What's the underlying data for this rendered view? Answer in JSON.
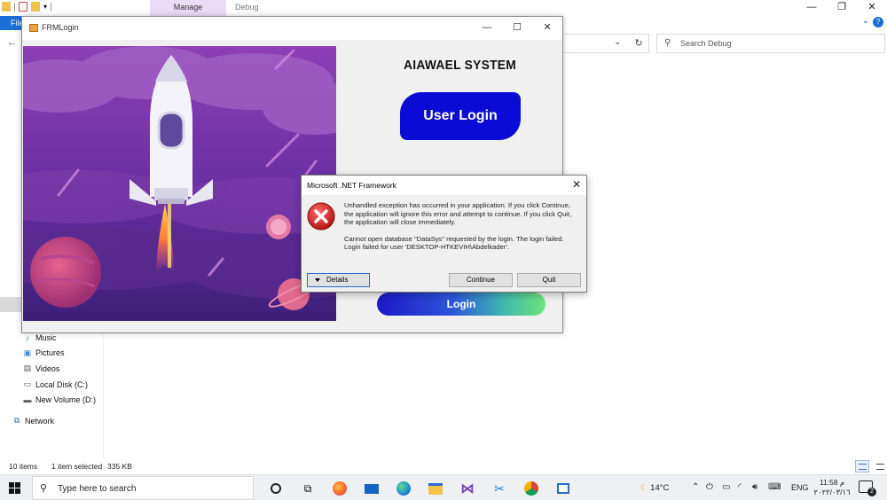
{
  "explorer": {
    "ribbon": {
      "manage_tab": "Manage",
      "debug_tab": "Debug",
      "file_tab": "File"
    },
    "search_placeholder": "Search Debug",
    "nav": [
      {
        "icon": "music-icon",
        "label": "Music"
      },
      {
        "icon": "pictures-icon",
        "label": "Pictures"
      },
      {
        "icon": "videos-icon",
        "label": "Videos"
      },
      {
        "icon": "drive-icon",
        "label": "Local Disk (C:)"
      },
      {
        "icon": "drive-icon",
        "label": "New Volume (D:)"
      },
      {
        "icon": "network-icon",
        "label": "Network"
      }
    ],
    "status": {
      "items": "10 items",
      "selected": "1 item selected",
      "size": "335 KB"
    }
  },
  "frm_login": {
    "title": "FRMLogin",
    "system_title": "AIAWAEL SYSTEM",
    "user_login": "User Login",
    "login_button": "Login"
  },
  "dialog": {
    "title": "Microsoft .NET Framework",
    "message_1": "Unhandled exception has occurred in your application. If you click Continue, the application will ignore this error and attempt to continue. If you click Quit, the application will close immediately.",
    "message_2": "Cannot open database \"DataSys\" requested by the login. The login failed.",
    "message_3": "Login failed for user 'DESKTOP-HTKEVIH\\Abdelkader'.",
    "details_button": "Details",
    "continue_button": "Continue",
    "quit_button": "Quit"
  },
  "taskbar": {
    "search_placeholder": "Type here to search",
    "weather": "14°C",
    "language": "ENG",
    "time": "11:58 م",
    "date": "٢٠٢٢/٠٣/١٦",
    "notification_count": "2",
    "apps": [
      "cortana-icon",
      "task-view-icon",
      "firefox-icon",
      "mail-icon",
      "edge-icon",
      "file-explorer-icon",
      "visual-studio-icon",
      "tool-icon",
      "chrome-icon",
      "app-window-icon"
    ]
  }
}
